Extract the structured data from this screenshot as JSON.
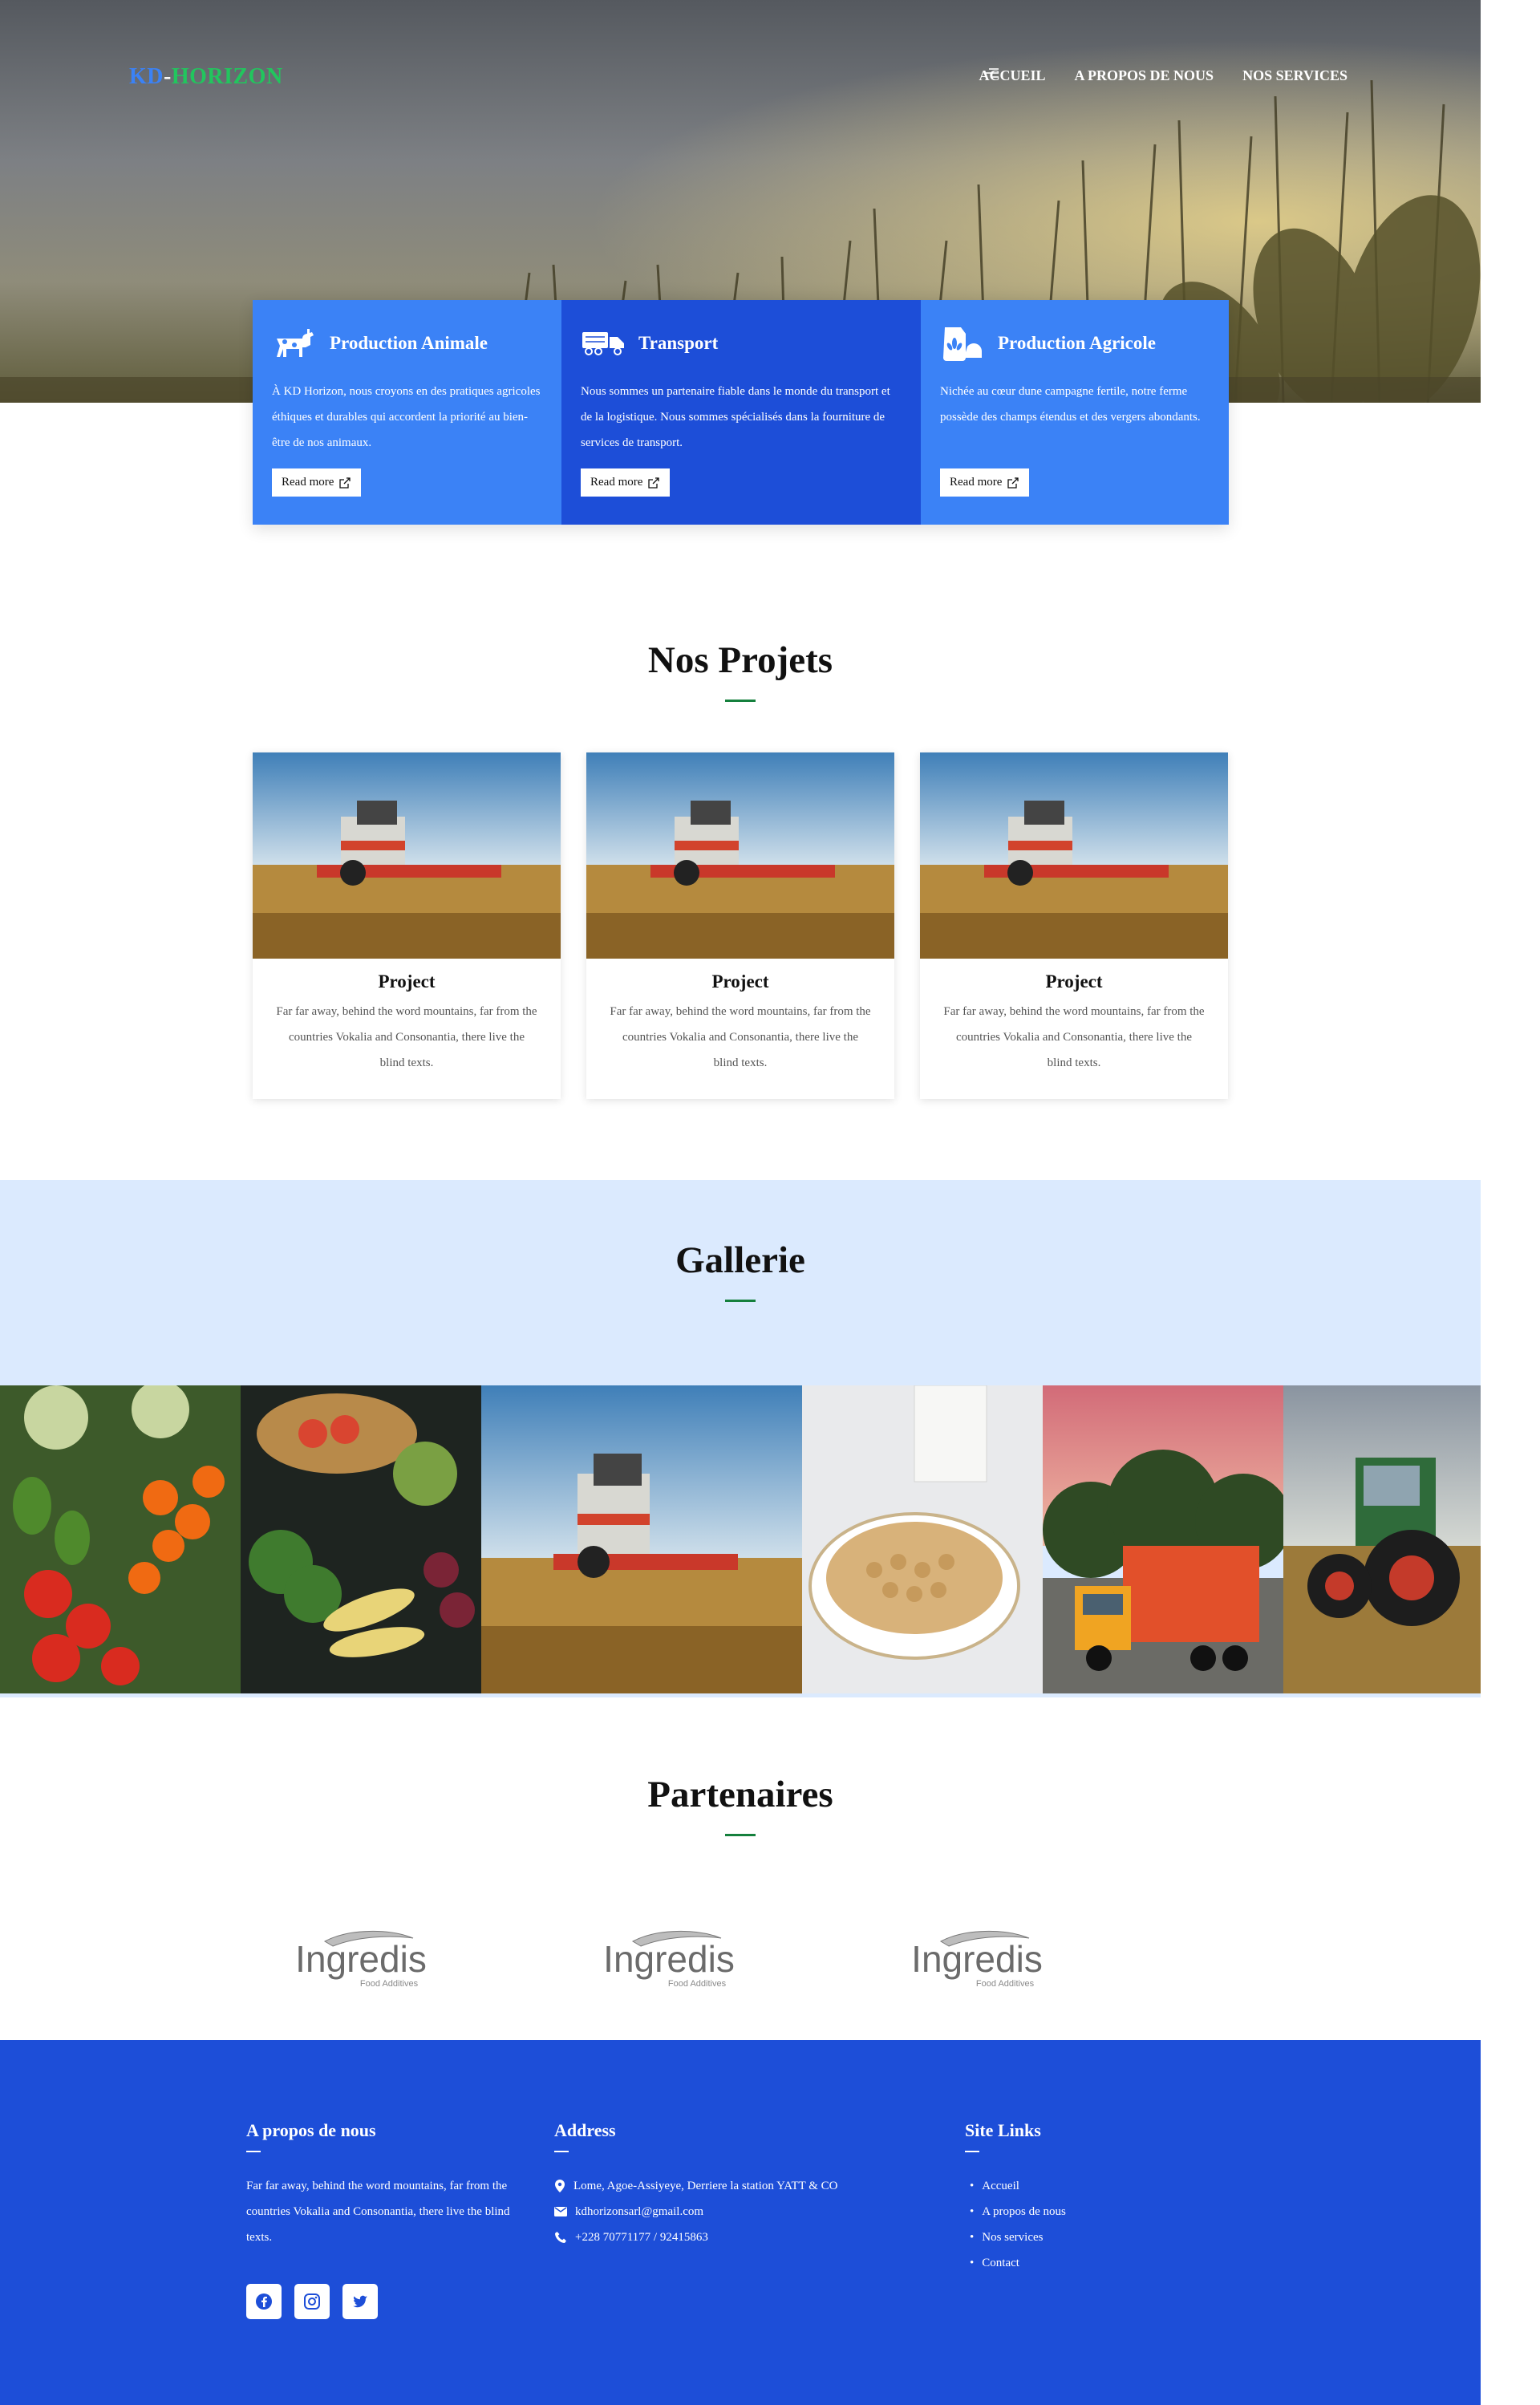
{
  "brand": {
    "part1": "KD",
    "sep": "-",
    "part2": "HORIZON"
  },
  "nav": {
    "items": [
      "ACCUEIL",
      "A PROPOS DE NOUS",
      "NOS SERVICES"
    ]
  },
  "services": [
    {
      "title": "Production Animale",
      "icon": "cow-icon",
      "text": "À KD Horizon, nous croyons en des pratiques agricoles éthiques et durables qui accordent la priorité au bien-être de nos animaux.",
      "button": "Read more"
    },
    {
      "title": "Transport",
      "icon": "truck-icon",
      "text": "Nous sommes un partenaire fiable dans le monde du transport et de la logistique. Nous sommes spécialisés dans la fourniture de services de transport.",
      "button": "Read more"
    },
    {
      "title": "Production Agricole",
      "icon": "grain-bag-icon",
      "text": "Nichée au cœur dune campagne fertile, notre ferme possède des champs étendus et des vergers abondants.",
      "button": "Read more"
    }
  ],
  "projects": {
    "title": "Nos Projets",
    "items": [
      {
        "title": "Project",
        "text": "Far far away, behind the word mountains, far from the countries Vokalia and Consonantia, there live the blind texts."
      },
      {
        "title": "Project",
        "text": "Far far away, behind the word mountains, far from the countries Vokalia and Consonantia, there live the blind texts."
      },
      {
        "title": "Project",
        "text": "Far far away, behind the word mountains, far from the countries Vokalia and Consonantia, there live the blind texts."
      }
    ]
  },
  "gallery": {
    "title": "Gallerie"
  },
  "partners": {
    "title": "Partenaires",
    "logos": [
      {
        "name": "Ingredis",
        "tagline": "Food Additives"
      },
      {
        "name": "Ingredis",
        "tagline": "Food Additives"
      },
      {
        "name": "Ingredis",
        "tagline": "Food Additives"
      }
    ]
  },
  "footer": {
    "about": {
      "title": "A propos de nous",
      "text": "Far far away, behind the word mountains, far from the countries Vokalia and Consonantia, there live the blind texts."
    },
    "address": {
      "title": "Address",
      "location": "Lome, Agoe-Assiyeye, Derriere la station YATT & CO",
      "email": "kdhorizonsarl@gmail.com",
      "phone": "+228 70771177 / 92415863"
    },
    "links": {
      "title": "Site Links",
      "items": [
        "Accueil",
        "A propos de nous",
        "Nos services",
        "Contact"
      ]
    }
  },
  "colors": {
    "primary": "#3b82f6",
    "primary_dark": "#1d4ed8",
    "accent_green": "#15803d",
    "gallery_bg": "#dbeafe"
  }
}
